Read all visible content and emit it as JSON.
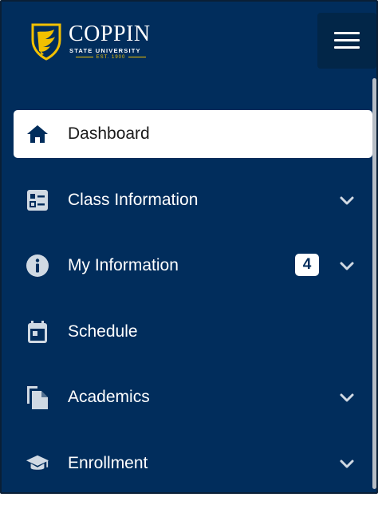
{
  "logo": {
    "name": "COPPIN",
    "subtitle": "STATE UNIVERSITY",
    "established": "EST. 1900"
  },
  "colors": {
    "sidebar_bg": "#012d5c",
    "menu_button_bg": "#022648",
    "gold": "#f2c000",
    "active_bg": "#ffffff"
  },
  "nav": {
    "items": [
      {
        "label": "Dashboard",
        "icon": "home-icon",
        "active": true
      },
      {
        "label": "Class Information",
        "icon": "class-info-icon",
        "expandable": true
      },
      {
        "label": "My Information",
        "icon": "info-icon",
        "expandable": true,
        "badge": "4"
      },
      {
        "label": "Schedule",
        "icon": "calendar-icon"
      },
      {
        "label": "Academics",
        "icon": "documents-icon",
        "expandable": true
      },
      {
        "label": "Enrollment",
        "icon": "graduation-cap-icon",
        "expandable": true
      }
    ]
  }
}
